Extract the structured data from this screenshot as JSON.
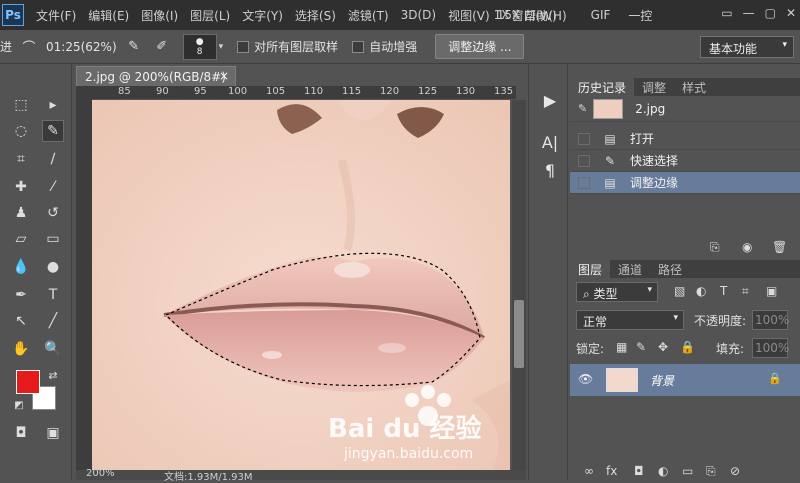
{
  "menubar": {
    "logo": "Ps",
    "items": [
      "文件(F)",
      "编辑(E)",
      "图像(I)",
      "图层(L)",
      "文字(Y)",
      "选择(S)",
      "滤镜(T)",
      "3D(D)",
      "视图(V)",
      "1X",
      "窗口(W)",
      "15X",
      "帮助(H)",
      "GIF",
      "一控"
    ],
    "window_controls": [
      "▭",
      "—",
      "▢",
      "✕"
    ]
  },
  "options": {
    "left_text": "进",
    "timer": "01:25(62%)",
    "brush_size": "8",
    "sample_all_label": "对所有图层取样",
    "auto_enhance_label": "自动增强",
    "refine_edge_button": "调整边缘 ...",
    "workspace": "基本功能"
  },
  "document": {
    "tab_title": "2.jpg @ 200%(RGB/8#)",
    "close": "×",
    "ruler_ticks": [
      "85",
      "90",
      "95",
      "100",
      "105",
      "110",
      "115",
      "120",
      "125",
      "130",
      "135"
    ],
    "status_zoom": "200%",
    "status_doc": "文档:1.93M/1.93M"
  },
  "history": {
    "tabs": [
      "历史记录",
      "调整",
      "样式"
    ],
    "snapshot_label": "2.jpg",
    "items": [
      {
        "label": "打开",
        "icon": "document-icon"
      },
      {
        "label": "快速选择",
        "icon": "quick-select-icon"
      },
      {
        "label": "调整边缘",
        "icon": "document-icon"
      }
    ]
  },
  "layers": {
    "tabs": [
      "图层",
      "通道",
      "路径"
    ],
    "filter_label": "类型",
    "blend_mode": "正常",
    "opacity_label": "不透明度:",
    "opacity_value": "100%",
    "lock_label": "锁定:",
    "fill_label": "填充:",
    "fill_value": "100%",
    "layer_name": "背景"
  },
  "watermark": {
    "brand": "Bai du 经验",
    "url": "jingyan.baidu.com"
  },
  "colors": {
    "foreground": "#e51a1a",
    "background": "#ffffff",
    "selected_row": "#677b9a"
  }
}
